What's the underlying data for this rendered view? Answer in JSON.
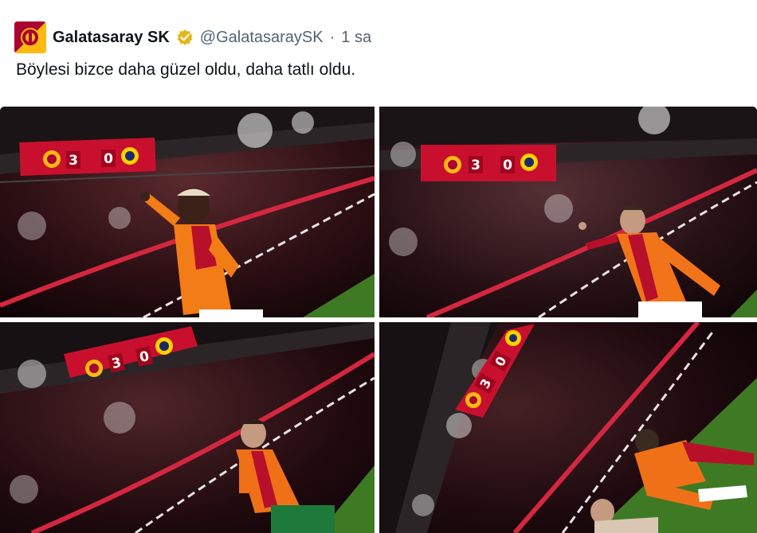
{
  "tweet": {
    "display_name": "Galatasaray SK",
    "handle": "@GalatasaraySK",
    "separator": "·",
    "time": "1 sa",
    "text": "Böylesi bizce daha güzel oldu, daha tatlı oldu."
  },
  "media": {
    "photos": [
      {
        "scoreboard": {
          "home": "3",
          "away": "0"
        }
      },
      {
        "scoreboard": {
          "home": "3",
          "away": "0"
        }
      },
      {
        "scoreboard": {
          "home": "3",
          "away": "0"
        }
      },
      {
        "scoreboard": {
          "home": "3",
          "away": "0"
        }
      }
    ]
  },
  "colors": {
    "brand_red": "#a90432",
    "brand_yellow": "#fdb912",
    "verified_gold": "#e2b719",
    "handle_gray": "#536471",
    "text": "#0f1419"
  }
}
